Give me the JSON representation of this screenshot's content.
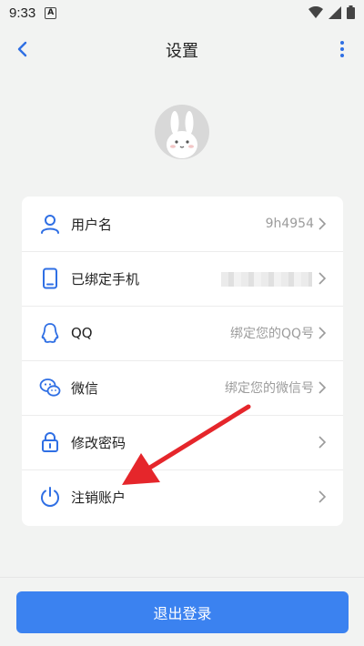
{
  "statusbar": {
    "time": "9:33",
    "badge": "A"
  },
  "navbar": {
    "title": "设置"
  },
  "menu": [
    {
      "label": "用户名",
      "value": "9h4954",
      "icon": "user-icon"
    },
    {
      "label": "已绑定手机",
      "value": "",
      "icon": "phone-icon"
    },
    {
      "label": "QQ",
      "value": "绑定您的QQ号",
      "icon": "qq-icon"
    },
    {
      "label": "微信",
      "value": "绑定您的微信号",
      "icon": "wechat-icon"
    },
    {
      "label": "修改密码",
      "value": "",
      "icon": "lock-icon"
    },
    {
      "label": "注销账户",
      "value": "",
      "icon": "power-icon"
    }
  ],
  "logout_label": "退出登录",
  "colors": {
    "accent": "#3b82f0",
    "icon_blue": "#2f6fe4",
    "arrow": "#e5262b"
  }
}
